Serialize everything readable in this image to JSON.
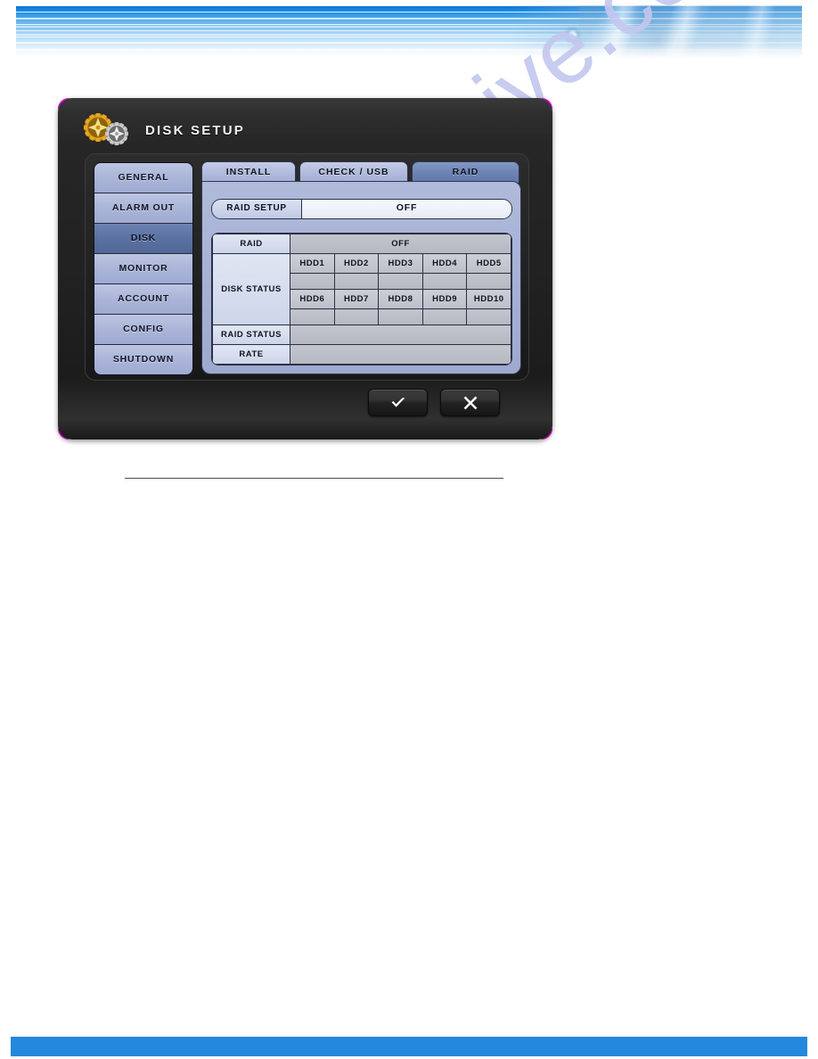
{
  "page": {
    "header_banner": "decorative-blue-gradient-banner",
    "footer_bar_color": "#2488dd",
    "watermark_text": "manualshive.com"
  },
  "dialog": {
    "title": "DISK SETUP",
    "title_icon_primary": "gold-gear-icon",
    "title_icon_secondary": "silver-gear-icon",
    "corner_marker_color": "#f306f3"
  },
  "sidebar": {
    "items": [
      {
        "label": "GENERAL",
        "selected": false
      },
      {
        "label": "ALARM OUT",
        "selected": false
      },
      {
        "label": "DISK",
        "selected": true
      },
      {
        "label": "MONITOR",
        "selected": false
      },
      {
        "label": "ACCOUNT",
        "selected": false
      },
      {
        "label": "CONFIG",
        "selected": false
      },
      {
        "label": "SHUTDOWN",
        "selected": false
      }
    ]
  },
  "tabs": [
    {
      "label": "INSTALL",
      "selected": false
    },
    {
      "label": "CHECK / USB",
      "selected": false
    },
    {
      "label": "RAID",
      "selected": true
    }
  ],
  "raid_setup": {
    "label": "RAID SETUP",
    "value": "OFF"
  },
  "status_table": {
    "raid_label": "RAID",
    "raid_value": "OFF",
    "disk_status_label": "DISK STATUS",
    "disk_row_1": [
      "HDD1",
      "HDD2",
      "HDD3",
      "HDD4",
      "HDD5"
    ],
    "disk_row_1_values": [
      "",
      "",
      "",
      "",
      ""
    ],
    "disk_row_2": [
      "HDD6",
      "HDD7",
      "HDD8",
      "HDD9",
      "HDD10"
    ],
    "disk_row_2_values": [
      "",
      "",
      "",
      "",
      ""
    ],
    "raid_status_label": "RAID STATUS",
    "raid_status_value": "",
    "rate_label": "RATE",
    "rate_value": ""
  },
  "buttons": {
    "confirm_icon": "checkmark-icon",
    "cancel_icon": "close-x-icon"
  }
}
